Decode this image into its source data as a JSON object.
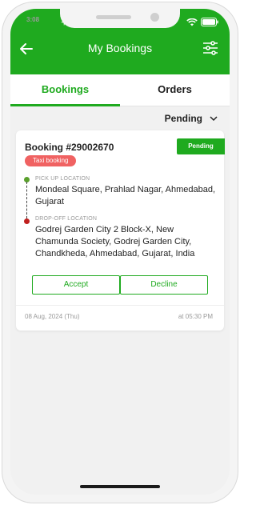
{
  "status_bar": {
    "time": "3:08"
  },
  "header": {
    "title": "My Bookings",
    "bg_color": "#1faa1f"
  },
  "tabs": [
    {
      "label": "Bookings",
      "active": true
    },
    {
      "label": "Orders",
      "active": false
    }
  ],
  "filter": {
    "selected": "Pending"
  },
  "booking": {
    "id": "Booking #29002670",
    "status": "Pending",
    "tag": "Taxi booking",
    "pickup": {
      "label": "PICK UP LOCATION",
      "address": "Mondeal Square, Prahlad Nagar, Ahmedabad, Gujarat"
    },
    "dropoff": {
      "label": "DROP-OFF LOCATION",
      "address": "Godrej Garden City 2 Block-X, New Chamunda Society, Godrej Garden City, Chandkheda, Ahmedabad, Gujarat, India"
    },
    "accept_label": "Accept",
    "decline_label": "Decline",
    "date": "08 Aug, 2024 (Thu)",
    "time": "at 05:30 PM"
  },
  "icons": {
    "back": "arrow-left-icon",
    "filter": "sliders-icon",
    "dropdown": "chevron-down-icon"
  }
}
